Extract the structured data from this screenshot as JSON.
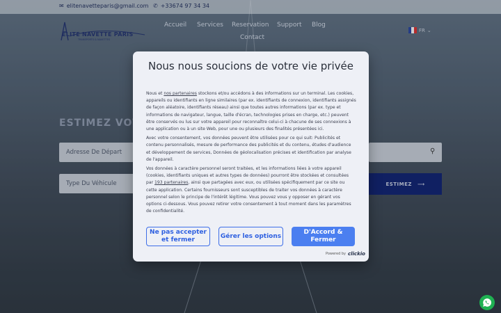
{
  "topbar": {
    "email": "elitenavetteparis@gmail.com",
    "phone": "+33674 97 34 34",
    "email_icon": "envelope-icon",
    "phone_icon": "phone-icon"
  },
  "logo": {
    "title": "ELITE NAVETTE PARIS",
    "subtitle": "TRANSPORTS & NAVETTES"
  },
  "nav": {
    "items": [
      "Accueil",
      "Services",
      "Reservation",
      "Support",
      "Blog",
      "Contact"
    ],
    "lang": "FR"
  },
  "form": {
    "heading": "ESTIMEZ VOT",
    "depart_placeholder": "Adresse De Départ",
    "vehicle_placeholder": "Type Du Véhicule",
    "estimate_button": "ESTIMEZ"
  },
  "consent": {
    "title": "Nous nous soucions de votre vie privée",
    "p1_a": "Nous et ",
    "p1_link": "nos partenaires",
    "p1_b": " stockons et/ou accédons à des informations sur un terminal. Les cookies, appareils ou identifiants en ligne similaires (par ex. identifiants de connexion, identifiants assignés de façon aléatoire, identifiants réseau) ainsi que toutes autres informations (par ex. type et informations de navigateur, langue, taille d'écran, technologies prises en charge, etc.) peuvent être conservés ou lus sur votre appareil pour reconnaître celui-ci à chacune de ses connexions à une application ou à un site Web, pour une ou plusieurs des finalités présentées ici.",
    "p2": "Avec votre consentement, vos données peuvent être utilisées pour ce qui suit: Publicités et contenu personnalisés, mesure de performance des publicités et du contenu, études d'audience et développement de services, Données de géolocalisation précises et identification par analyse de l'appareil.",
    "p3_a": "Vos données à caractère personnel seront traitées, et les informations liées à votre appareil (cookies, identifiants uniques et autres types de données) pourront être stockées et consultées par ",
    "p3_link": "193 partenaires",
    "p3_b": ", ainsi que partagées avec eux, ou utilisées spécifiquement par ce site ou cette application. Certains fournisseurs sont susceptibles de traiter vos données à caractère personnel selon le principe de l'intérêt légitime. Vous pouvez vous y opposer en gérant vos options ci-dessous. Vous pouvez retirer votre consentement à tout moment dans les paramètres de confidentialité.",
    "btn_reject": "Ne pas accepter et fermer",
    "btn_manage": "Gérer les options",
    "btn_accept": "D'Accord & Fermer",
    "powered_label": "Powered by",
    "powered_brand": "clickio"
  },
  "colors": {
    "accent": "#4b7ff0",
    "nav_dark": "#0b1e6d",
    "whatsapp": "#1fb152"
  }
}
